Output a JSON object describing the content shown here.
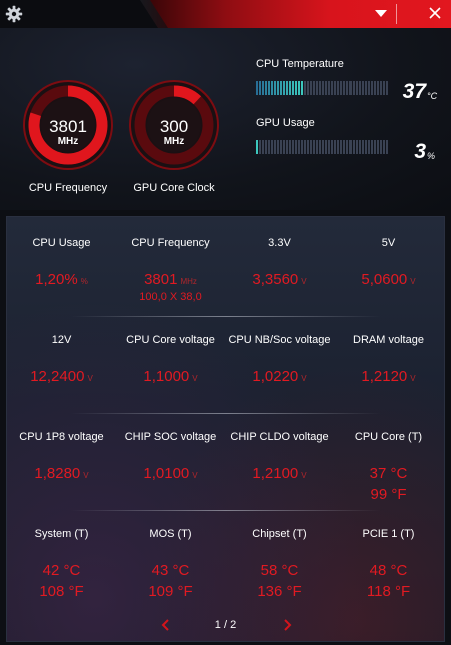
{
  "window": {
    "settings_icon": "gear-icon",
    "dropdown_icon": "triangle-down-icon",
    "close_icon": "close-icon",
    "accent_color": "#e2171f"
  },
  "gauges": [
    {
      "value": "3801",
      "unit": "MHz",
      "label": "CPU Frequency",
      "fill": 0.8
    },
    {
      "value": "300",
      "unit": "MHz",
      "label": "GPU Core Clock",
      "fill": 0.12
    }
  ],
  "bars": {
    "cpu_temp": {
      "label": "CPU Temperature",
      "value": "37",
      "unit": "°C",
      "level": 0.37
    },
    "gpu_usage": {
      "label": "GPU Usage",
      "value": "3",
      "unit": "%",
      "level": 0.03
    }
  },
  "grid": [
    [
      {
        "label": "CPU Usage",
        "value": "1,20%",
        "unit": "%"
      },
      {
        "label": "CPU Frequency",
        "value": "3801",
        "unit": "MHz",
        "sub": "100,0 X 38,0"
      },
      {
        "label": "3.3V",
        "value": "3,3560",
        "unit": "V"
      },
      {
        "label": "5V",
        "value": "5,0600",
        "unit": "V"
      }
    ],
    [
      {
        "label": "12V",
        "value": "12,2400",
        "unit": "V"
      },
      {
        "label": "CPU Core voltage",
        "value": "1,1000",
        "unit": "V"
      },
      {
        "label": "CPU NB/Soc voltage",
        "value": "1,0220",
        "unit": "V"
      },
      {
        "label": "DRAM voltage",
        "value": "1,2120",
        "unit": "V"
      }
    ],
    [
      {
        "label": "CPU 1P8 voltage",
        "value": "1,8280",
        "unit": "V"
      },
      {
        "label": "CHIP SOC voltage",
        "value": "1,0100",
        "unit": "V"
      },
      {
        "label": "CHIP CLDO voltage",
        "value": "1,2100",
        "unit": "V"
      },
      {
        "label": "CPU Core (T)",
        "value": "37 °C",
        "value2": "99 °F"
      }
    ],
    [
      {
        "label": "System (T)",
        "value": "42 °C",
        "value2": "108 °F"
      },
      {
        "label": "MOS (T)",
        "value": "43 °C",
        "value2": "109 °F"
      },
      {
        "label": "Chipset (T)",
        "value": "58 °C",
        "value2": "136 °F"
      },
      {
        "label": "PCIE 1 (T)",
        "value": "48 °C",
        "value2": "118 °F"
      }
    ]
  ],
  "pager": {
    "text": "1 / 2",
    "prev_icon": "chevron-left-icon",
    "next_icon": "chevron-right-icon"
  }
}
